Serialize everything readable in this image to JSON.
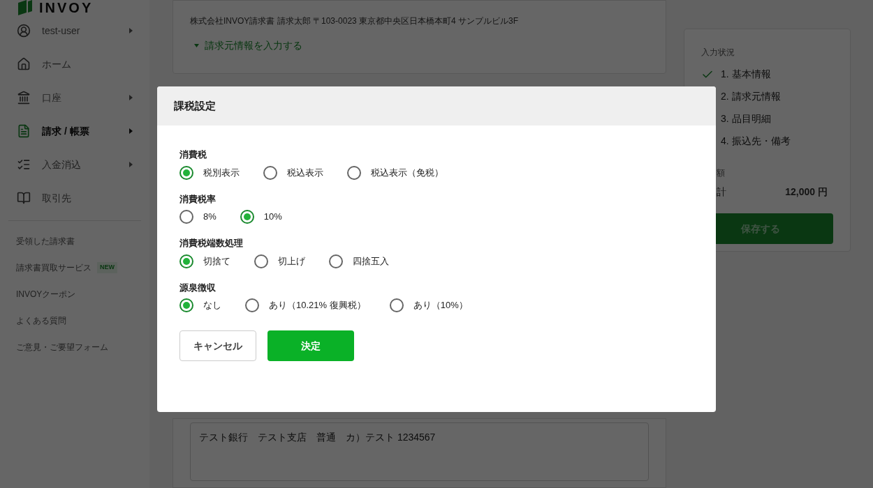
{
  "sidebar": {
    "logo": "INVOY",
    "items": [
      {
        "label": "test-user",
        "selected": false,
        "submenu": true
      },
      {
        "label": "ホーム",
        "selected": false,
        "submenu": false
      },
      {
        "label": "口座",
        "selected": false,
        "submenu": true
      },
      {
        "label": "請求 / 帳票",
        "selected": true,
        "submenu": true
      },
      {
        "label": "入金消込",
        "selected": false,
        "submenu": true
      },
      {
        "label": "取引先",
        "selected": false,
        "submenu": false
      }
    ],
    "links": [
      {
        "label": "受領した請求書"
      },
      {
        "label": "請求書買取サービス",
        "badge": "NEW"
      },
      {
        "label": "INVOYクーポン"
      },
      {
        "label": "よくある質問"
      },
      {
        "label": "ご意見・ご要望フォーム"
      }
    ]
  },
  "main": {
    "issuer_text": "株式会社INVOY請求書 請求太郎 〒103-0023 東京都中央区日本橋本町4 サンプルビル3F",
    "expand_link": "請求元情報を入力する",
    "account_value": "テスト銀行　テスト支店　普通　カ）テスト 1234567"
  },
  "status_panel": {
    "title": "入力状況",
    "steps": [
      {
        "label": "1. 基本情報",
        "done": true
      },
      {
        "label": "2. 請求元情報"
      },
      {
        "label": "3. 品目明細"
      },
      {
        "label": "4. 振込先・備考"
      }
    ],
    "total_heading": "額",
    "total_label": "計",
    "total_amount": "12,000 円",
    "save_button": "保存する"
  },
  "modal": {
    "title": "課税設定",
    "groups": [
      {
        "label": "消費税",
        "options": [
          {
            "label": "税別表示",
            "selected": true
          },
          {
            "label": "税込表示",
            "selected": false
          },
          {
            "label": "税込表示（免税）",
            "selected": false
          }
        ]
      },
      {
        "label": "消費税率",
        "options": [
          {
            "label": "8%",
            "selected": false
          },
          {
            "label": "10%",
            "selected": true
          }
        ]
      },
      {
        "label": "消費税端数処理",
        "options": [
          {
            "label": "切捨て",
            "selected": true
          },
          {
            "label": "切上げ",
            "selected": false
          },
          {
            "label": "四捨五入",
            "selected": false
          }
        ]
      },
      {
        "label": "源泉徴収",
        "options": [
          {
            "label": "なし",
            "selected": true
          },
          {
            "label": "あり（10.21% 復興税）",
            "selected": false
          },
          {
            "label": "あり（10%）",
            "selected": false
          }
        ]
      }
    ],
    "cancel_button": "キャンセル",
    "confirm_button": "決定"
  }
}
